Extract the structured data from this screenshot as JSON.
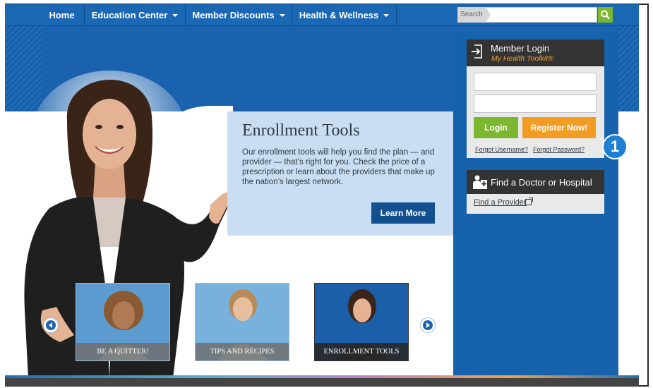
{
  "nav": {
    "items": [
      {
        "label": "Home",
        "dropdown": false
      },
      {
        "label": "Education Center",
        "dropdown": true
      },
      {
        "label": "Member Discounts",
        "dropdown": true
      },
      {
        "label": "Health & Wellness",
        "dropdown": true
      }
    ],
    "search_label": "Search",
    "search_icon": "magnifier-icon"
  },
  "hero": {
    "title": "Enrollment Tools",
    "body": "Our enrollment tools will help you find the plan — and provider — that’s right for you. Check the price of a prescription or learn about the providers that make up the nation’s largest network.",
    "cta": "Learn More"
  },
  "login": {
    "title": "Member Login",
    "subtitle": "My Health Toolkit®",
    "login_btn": "Login",
    "register_btn": "Register Now!",
    "forgot_username": "Forgot Username?",
    "forgot_password": "Forgot Password?",
    "badge": "1"
  },
  "doctor": {
    "title": "Find a Doctor or Hospital",
    "link": "Find a Provider"
  },
  "thumbs": [
    {
      "label": "BE A QUITTER!"
    },
    {
      "label": "TIPS AND RECIPES"
    },
    {
      "label": "ENROLLMENT TOOLS"
    }
  ],
  "colors": {
    "nav_blue": "#1a67b3",
    "green": "#7cb82f",
    "orange": "#f39c22",
    "dark": "#333333"
  }
}
